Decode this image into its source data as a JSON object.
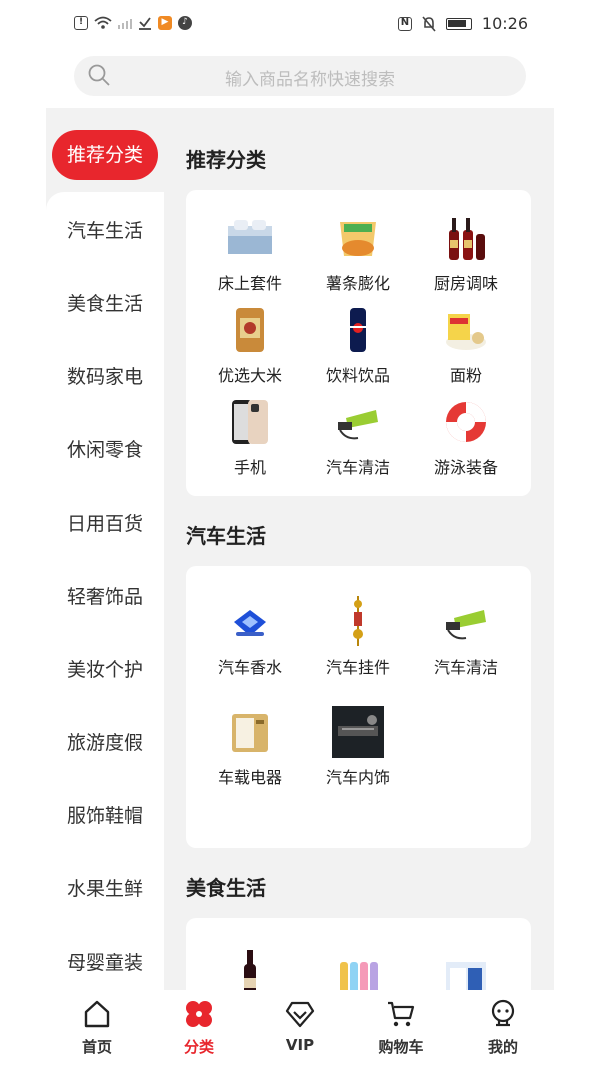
{
  "status_bar": {
    "time": "10:26"
  },
  "search": {
    "placeholder": "输入商品名称快速搜索"
  },
  "sidebar": {
    "active": "推荐分类",
    "items": [
      "汽车生活",
      "美食生活",
      "数码家电",
      "休闲零食",
      "日用百货",
      "轻奢饰品",
      "美妆个护",
      "旅游度假",
      "服饰鞋帽",
      "水果生鲜",
      "母婴童装"
    ]
  },
  "sections": [
    {
      "title": "推荐分类",
      "items": [
        "床上套件",
        "薯条膨化",
        "厨房调味",
        "优选大米",
        "饮料饮品",
        "面粉",
        "手机",
        "汽车清洁",
        "游泳装备"
      ]
    },
    {
      "title": "汽车生活",
      "items": [
        "汽车香水",
        "汽车挂件",
        "汽车清洁",
        "车载电器",
        "汽车内饰"
      ]
    },
    {
      "title": "美食生活",
      "items": [
        "",
        "",
        ""
      ]
    }
  ],
  "tabbar": {
    "tabs": [
      "首页",
      "分类",
      "VIP",
      "购物车",
      "我的"
    ],
    "active_index": 1
  },
  "colors": {
    "accent": "#e8262d",
    "panel_bg": "#f2f2f2"
  }
}
